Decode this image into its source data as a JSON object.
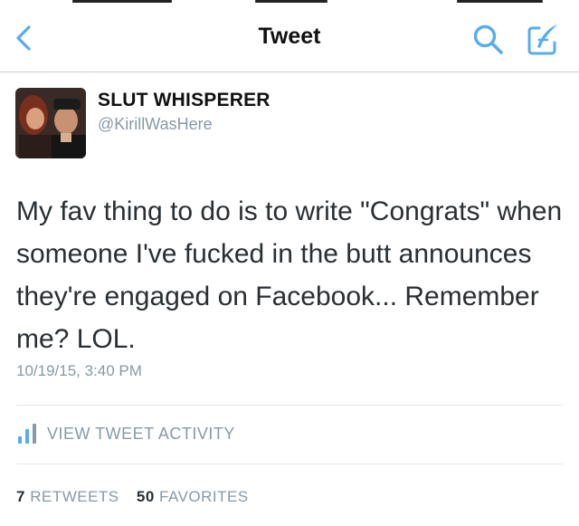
{
  "navbar": {
    "title": "Tweet",
    "back_icon": "chevron-left-icon",
    "search_icon": "search-icon",
    "compose_icon": "compose-icon",
    "accent_color": "#55acee"
  },
  "tweet": {
    "display_name": "SLUT WHISPERER",
    "handle": "@KirillWasHere",
    "text": "My fav thing to do is to write \"Congrats\" when someone I've fucked in the butt announces they're engaged on Facebook... Remember me? LOL.",
    "timestamp": "10/19/15, 3:40 PM"
  },
  "activity": {
    "label": "VIEW TWEET ACTIVITY",
    "icon": "bar-chart-icon"
  },
  "stats": {
    "retweets_count": "7",
    "retweets_label": "RETWEETS",
    "favorites_count": "50",
    "favorites_label": "FAVORITES"
  }
}
